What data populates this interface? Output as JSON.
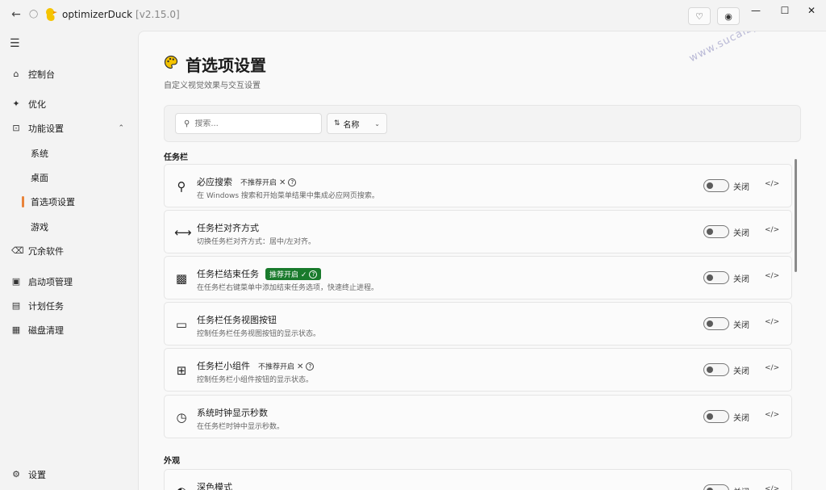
{
  "window": {
    "app_name": "optimizerDuck",
    "version": "[v2.15.0]",
    "back_icon": "arrow-left-icon",
    "favorite_icon": "heart-icon",
    "screenshot_icon": "camera-icon"
  },
  "sidebar": {
    "items": [
      {
        "label": "控制台",
        "icon": "home-icon"
      },
      {
        "label": "优化",
        "icon": "rocket-icon"
      },
      {
        "label": "功能设置",
        "icon": "toggle-icon"
      },
      {
        "label": "系统"
      },
      {
        "label": "桌面"
      },
      {
        "label": "首选项设置"
      },
      {
        "label": "游戏"
      },
      {
        "label": "冗余软件",
        "icon": "trash-icon"
      },
      {
        "label": "启动项管理",
        "icon": "startup-icon"
      },
      {
        "label": "计划任务",
        "icon": "task-icon"
      },
      {
        "label": "磁盘清理",
        "icon": "disk-icon"
      }
    ],
    "settings_label": "设置"
  },
  "page": {
    "title": "首选项设置",
    "subtitle": "自定义视觉效果与交互设置",
    "watermark": "www.sucaizy.com",
    "search_placeholder": "搜索...",
    "sort_label": "名称"
  },
  "sections": {
    "taskbar": "任务栏",
    "appearance": "外观"
  },
  "settings": [
    {
      "title": "必应搜索",
      "tag": "不推荐开启",
      "desc": "在 Windows 搜索和开始菜单结果中集成必应网页搜索。",
      "state": "关闭"
    },
    {
      "title": "任务栏对齐方式",
      "desc": "切换任务栏对齐方式：居中/左对齐。",
      "state": "关闭"
    },
    {
      "title": "任务栏结束任务",
      "tag": "推荐开启",
      "desc": "在任务栏右键菜单中添加结束任务选项，快速终止进程。",
      "state": "关闭"
    },
    {
      "title": "任务栏任务视图按钮",
      "desc": "控制任务栏任务视图按钮的显示状态。",
      "state": "关闭"
    },
    {
      "title": "任务栏小组件",
      "tag": "不推荐开启",
      "desc": "控制任务栏小组件按钮的显示状态。",
      "state": "关闭"
    },
    {
      "title": "系统时钟显示秒数",
      "desc": "在任务栏时钟中显示秒数。",
      "state": "关闭"
    },
    {
      "title": "深色模式",
      "desc": "",
      "state": "关闭"
    }
  ],
  "colors": {
    "accent": "#e8833a",
    "recommend": "#197a2c"
  }
}
